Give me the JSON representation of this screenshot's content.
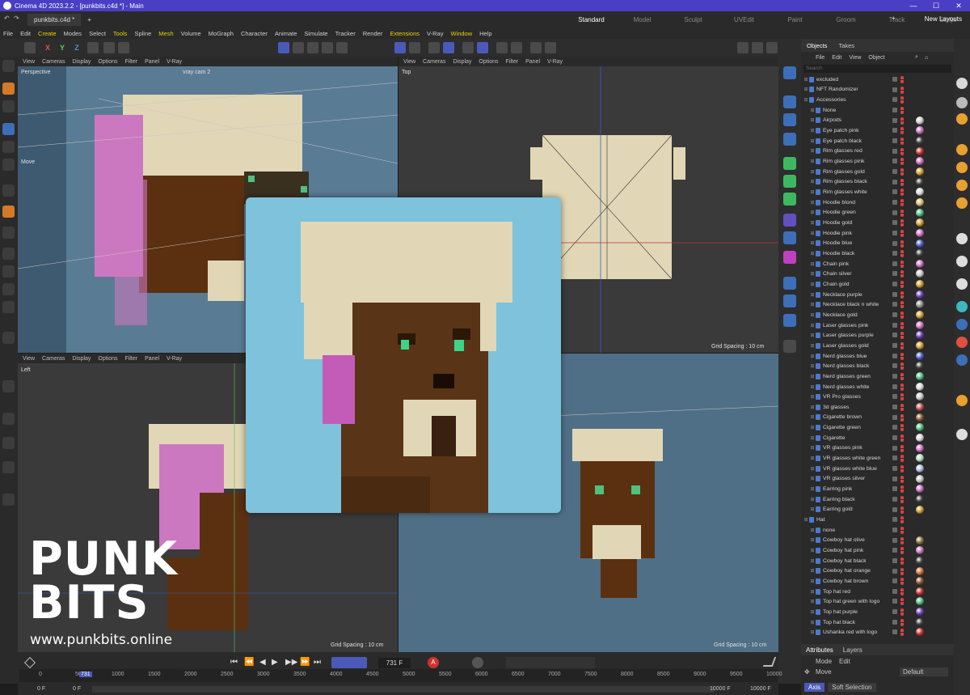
{
  "window": {
    "title": "Cinema 4D 2023.2.2 - [punkbits.c4d *] - Main",
    "min": "—",
    "max": "☐",
    "close": "✕"
  },
  "tabs": {
    "doc": "punkbits.c4d *",
    "new": "+"
  },
  "layouts": [
    "Standard",
    "Model",
    "Sculpt",
    "UVEdit",
    "Paint",
    "Groom",
    "Track",
    "Script",
    "Nodes"
  ],
  "new_layouts": "New Layouts",
  "menu": [
    "File",
    "Edit",
    "Create",
    "Modes",
    "Select",
    "Tools",
    "Spline",
    "Mesh",
    "Volume",
    "MoGraph",
    "Character",
    "Animate",
    "Simulate",
    "Tracker",
    "Render",
    "Extensions",
    "V-Ray",
    "Window",
    "Help"
  ],
  "menu_highlight": [
    "Create",
    "Tools",
    "Mesh",
    "Extensions",
    "Window"
  ],
  "axes": {
    "x": "X",
    "y": "Y",
    "z": "Z"
  },
  "viewport_menu": [
    "View",
    "Cameras",
    "Display",
    "Options",
    "Filter",
    "Panel",
    "V-Ray"
  ],
  "viewports": {
    "perspective": {
      "label": "Perspective",
      "camera": "vray cam 2",
      "tool": "Move"
    },
    "top": {
      "label": "Top",
      "grid": "Grid Spacing : 10 cm"
    },
    "left": {
      "label": "Left",
      "grid": "Grid Spacing : 10 cm"
    },
    "front": {
      "grid": "Grid Spacing : 10 cm"
    }
  },
  "branding": {
    "line1": "PUNK",
    "line2": "BITS",
    "url": "www.punkbits.online"
  },
  "objects_panel": {
    "tabs": [
      "Objects",
      "Takes"
    ],
    "menu": [
      "File",
      "Edit",
      "View",
      "Object"
    ],
    "search_placeholder": "Search",
    "items": [
      {
        "name": "excluded",
        "level": 0,
        "mat": ""
      },
      {
        "name": "NFT Randomizer",
        "level": 0,
        "mat": ""
      },
      {
        "name": "Accessories",
        "level": 0,
        "mat": ""
      },
      {
        "name": "None",
        "level": 1,
        "mat": ""
      },
      {
        "name": "Airpods",
        "level": 1,
        "mat": "#cfcfcf"
      },
      {
        "name": "Eye patch pink",
        "level": 1,
        "mat": "#d070c0"
      },
      {
        "name": "Eye patch black",
        "level": 1,
        "mat": "#404040"
      },
      {
        "name": "Rim glasses red",
        "level": 1,
        "mat": "#d03030"
      },
      {
        "name": "Rim glasses pink",
        "level": 1,
        "mat": "#d070c0"
      },
      {
        "name": "Rim glasses gold",
        "level": 1,
        "mat": "#d0a030"
      },
      {
        "name": "Rim glasses black",
        "level": 1,
        "mat": "#404040"
      },
      {
        "name": "Rim glasses white",
        "level": 1,
        "mat": "#d8d8d8"
      },
      {
        "name": "Hoodie blond",
        "level": 1,
        "mat": "#d8c070"
      },
      {
        "name": "Hoodie green",
        "level": 1,
        "mat": "#50c080"
      },
      {
        "name": "Hoodie gold",
        "level": 1,
        "mat": "#d0a030"
      },
      {
        "name": "Hoodie pink",
        "level": 1,
        "mat": "#d070c0"
      },
      {
        "name": "Hoodie blue",
        "level": 1,
        "mat": "#5060d0"
      },
      {
        "name": "Hoodie black",
        "level": 1,
        "mat": "#404040"
      },
      {
        "name": "Chain pink",
        "level": 1,
        "mat": "#d070c0"
      },
      {
        "name": "Chain silver",
        "level": 1,
        "mat": "#c8c8c8"
      },
      {
        "name": "Chain gold",
        "level": 1,
        "mat": "#d0a030"
      },
      {
        "name": "Necklace purple",
        "level": 1,
        "mat": "#7040c0"
      },
      {
        "name": "Necklace black n white",
        "level": 1,
        "mat": "#909090"
      },
      {
        "name": "Necklace gold",
        "level": 1,
        "mat": "#d0a030"
      },
      {
        "name": "Laser glasses pink",
        "level": 1,
        "mat": "#d070c0"
      },
      {
        "name": "Laser glasses purple",
        "level": 1,
        "mat": "#7040c0"
      },
      {
        "name": "Laser glasses gold",
        "level": 1,
        "mat": "#d0a030"
      },
      {
        "name": "Nerd glasses blue",
        "level": 1,
        "mat": "#5060d0"
      },
      {
        "name": "Nerd glasses black",
        "level": 1,
        "mat": "#404040"
      },
      {
        "name": "Nerd glasses green",
        "level": 1,
        "mat": "#50c080"
      },
      {
        "name": "Nerd glasses white",
        "level": 1,
        "mat": "#d8d8d8"
      },
      {
        "name": "VR Pro glasses",
        "level": 1,
        "mat": "#c8c8c8"
      },
      {
        "name": "3d glasses",
        "level": 1,
        "mat": "#d05050"
      },
      {
        "name": "Cigarette brown",
        "level": 1,
        "mat": "#8a5a30"
      },
      {
        "name": "Cigarette green",
        "level": 1,
        "mat": "#50c080"
      },
      {
        "name": "Cigarette",
        "level": 1,
        "mat": "#d8d8d8"
      },
      {
        "name": "VR glasses pink",
        "level": 1,
        "mat": "#d070c0"
      },
      {
        "name": "VR glasses white green",
        "level": 1,
        "mat": "#b0e0c0"
      },
      {
        "name": "VR glasses white blue",
        "level": 1,
        "mat": "#b0c0e0"
      },
      {
        "name": "VR glasses silver",
        "level": 1,
        "mat": "#c8c8c8"
      },
      {
        "name": "Earring pink",
        "level": 1,
        "mat": "#d070c0"
      },
      {
        "name": "Earring black",
        "level": 1,
        "mat": "#404040"
      },
      {
        "name": "Earring gold",
        "level": 1,
        "mat": "#d0a030"
      },
      {
        "name": "Hat",
        "level": 0,
        "mat": ""
      },
      {
        "name": "none",
        "level": 1,
        "mat": ""
      },
      {
        "name": "Cowboy hat olive",
        "level": 1,
        "mat": "#8a7a40"
      },
      {
        "name": "Cowboy hat pink",
        "level": 1,
        "mat": "#d070c0"
      },
      {
        "name": "Cowboy hat black",
        "level": 1,
        "mat": "#404040"
      },
      {
        "name": "Cowboy hat orange",
        "level": 1,
        "mat": "#d07030"
      },
      {
        "name": "Cowboy hat brown",
        "level": 1,
        "mat": "#8a5a30"
      },
      {
        "name": "Top hat red",
        "level": 1,
        "mat": "#d03030"
      },
      {
        "name": "Top hat green with logo",
        "level": 1,
        "mat": "#50c080"
      },
      {
        "name": "Top hat purple",
        "level": 1,
        "mat": "#7040c0"
      },
      {
        "name": "Top hat black",
        "level": 1,
        "mat": "#404040"
      },
      {
        "name": "Ushanka red with logo",
        "level": 1,
        "mat": "#d03030"
      }
    ]
  },
  "attributes": {
    "tabs": [
      "Attributes",
      "Layers"
    ],
    "menu": [
      "Mode",
      "Edit"
    ],
    "tool": "Move",
    "preset": "Default",
    "subtabs": [
      "Axis",
      "Soft Selection"
    ]
  },
  "timeline": {
    "current_frame": "731 F",
    "ruler_ticks": [
      "0",
      "500",
      "1000",
      "1500",
      "2000",
      "2500",
      "3000",
      "3500",
      "4000",
      "4500",
      "5000",
      "5500",
      "6000",
      "6500",
      "7000",
      "7500",
      "8000",
      "8500",
      "9000",
      "9500",
      "10000"
    ],
    "playhead_label": "731",
    "start_a": "0 F",
    "start_b": "0 F",
    "end_a": "10000 F",
    "end_b": "10000 F",
    "record_label": "A"
  },
  "colors": {
    "accent": "#4a3ec4",
    "highlight_menu": "#e8d000",
    "overlay_bg": "#7ec2dc"
  }
}
